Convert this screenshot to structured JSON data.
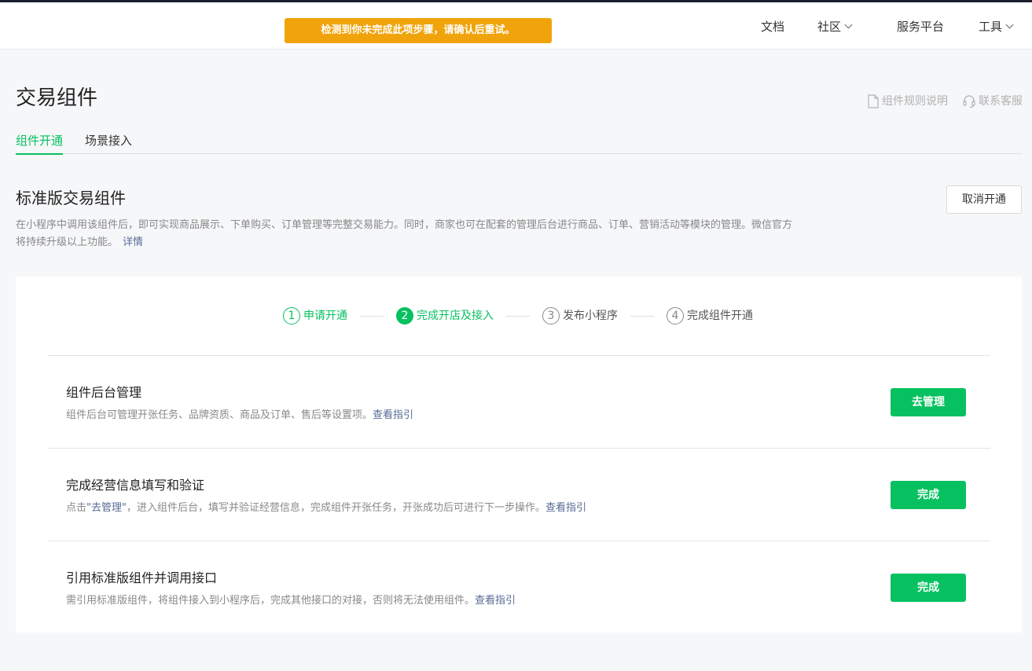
{
  "toast": {
    "message": "检测到你未完成此项步骤，请确认后重试。"
  },
  "nav": {
    "docs": "文档",
    "community": "社区",
    "service_platform": "服务平台",
    "tools": "工具"
  },
  "page": {
    "title": "交易组件",
    "rules_link": "组件规则说明",
    "support_link": "联系客服"
  },
  "tabs": [
    {
      "label": "组件开通",
      "active": true
    },
    {
      "label": "场景接入",
      "active": false
    }
  ],
  "section": {
    "title": "标准版交易组件",
    "desc_line1": "在小程序中调用该组件后，即可实现商品展示、下单购买、订单管理等完整交易能力。同时，商家也可在配套的管理后台进行商品、订单、营销活动等模块的管理。微信官方",
    "desc_line2": "将持续升级以上功能。",
    "details_link": "详情",
    "cancel_button": "取消开通"
  },
  "steps": [
    {
      "num": "1",
      "label": "申请开通",
      "state": "done"
    },
    {
      "num": "2",
      "label": "完成开店及接入",
      "state": "current"
    },
    {
      "num": "3",
      "label": "发布小程序",
      "state": "todo"
    },
    {
      "num": "4",
      "label": "完成组件开通",
      "state": "todo"
    }
  ],
  "tasks": [
    {
      "title": "组件后台管理",
      "desc": "组件后台可管理开张任务、品牌资质、商品及订单、售后等设置项。",
      "guide": "查看指引",
      "button": "去管理"
    },
    {
      "title": "完成经营信息填写和验证",
      "desc_prefix": "点击",
      "desc_highlight": "\"去管理\"",
      "desc_suffix": "，进入组件后台，填写并验证经营信息，完成组件开张任务，开张成功后可进行下一步操作。",
      "guide": "查看指引",
      "button": "完成"
    },
    {
      "title": "引用标准版组件并调用接口",
      "desc": "需引用标准版组件，将组件接入到小程序后，完成其他接口的对接，否则将无法使用组件。",
      "guide": "查看指引",
      "button": "完成"
    }
  ],
  "colors": {
    "brand_green": "#07c160",
    "warning": "#f0a30a",
    "link": "#576b95"
  }
}
